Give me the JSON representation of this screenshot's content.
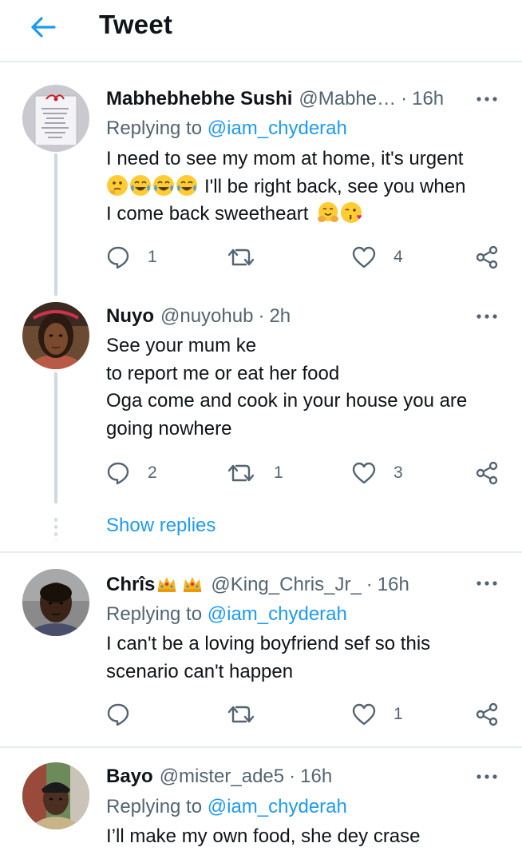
{
  "header": {
    "title": "Tweet"
  },
  "tweets": [
    {
      "name": "Mabhebhebhe Sushi",
      "handle": "@Mabhe…",
      "time": "16h",
      "replying_prefix": "Replying to ",
      "replying_to": "@iam_chyderah",
      "lines": [
        "I need to see my mom at home, it's urgent",
        "I'll be right back, see you  when",
        "I come back sweetheart"
      ],
      "emojis_line2": [
        "thinking-face-emoji",
        "tears-of-joy-emoji",
        "tears-of-joy-emoji",
        "tears-of-joy-emoji"
      ],
      "emojis_line3": [
        "hugging-face-emoji",
        "face-blowing-kiss-emoji"
      ],
      "replies": "1",
      "retweets": "",
      "likes": "4"
    },
    {
      "name": "Nuyo",
      "handle": "@nuyohub",
      "time": "2h",
      "lines": [
        "See your mum ke",
        "to report me or eat her food",
        "Oga come and cook in your house you are",
        "going nowhere"
      ],
      "replies": "2",
      "retweets": "1",
      "likes": "3",
      "show_replies": "Show replies"
    },
    {
      "name": "Chrîs",
      "name_emojis": [
        "crown-emoji",
        "crown-emoji"
      ],
      "handle": "@King_Chris_Jr_",
      "time": "16h",
      "replying_prefix": "Replying to ",
      "replying_to": "@iam_chyderah",
      "lines": [
        "I can't be a loving boyfriend sef so this",
        "scenario can't happen"
      ],
      "replies": "",
      "retweets": "",
      "likes": "1"
    },
    {
      "name": "Bayo",
      "handle": "@mister_ade5",
      "time": "16h",
      "replying_prefix": "Replying to ",
      "replying_to": "@iam_chyderah",
      "lines": [
        "I’ll make my own food, she dey crase"
      ]
    }
  ],
  "separator": "·",
  "colors": {
    "accent": "#1d9bf0",
    "secondary_text": "#536471",
    "divider": "#e6ecf0"
  }
}
